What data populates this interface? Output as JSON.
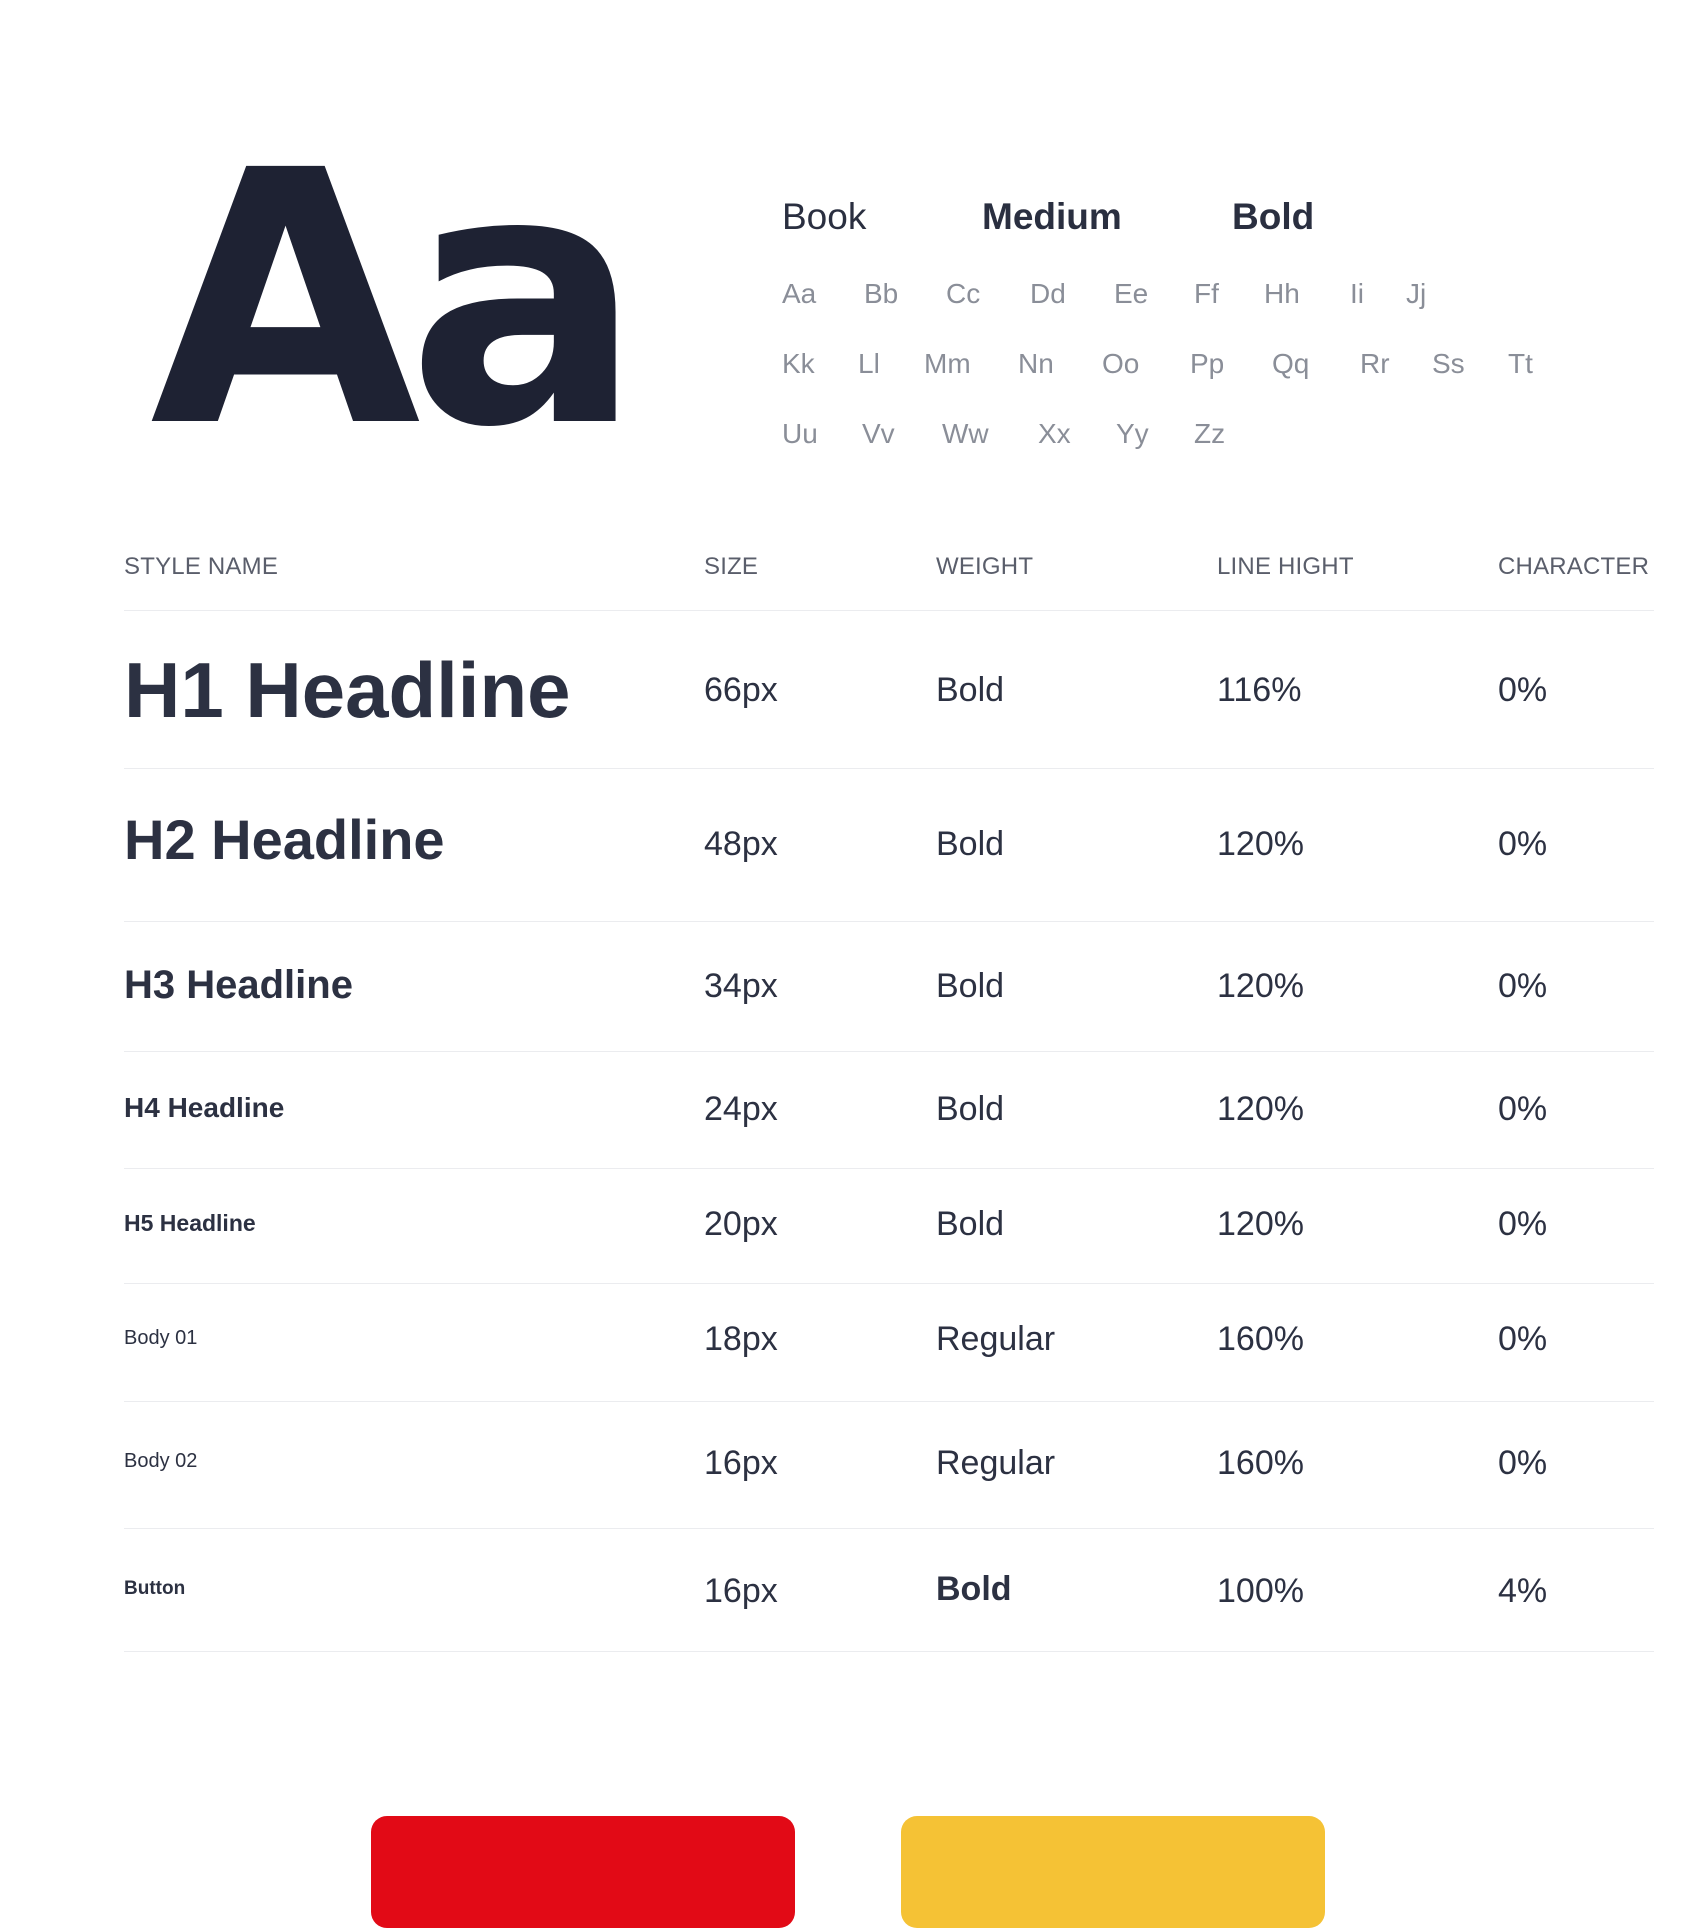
{
  "specimen": {
    "glyph": "Aa"
  },
  "weights": {
    "book": "Book",
    "medium": "Medium",
    "bold": "Bold"
  },
  "alphabet": {
    "row1": [
      "Aa",
      "Bb",
      "Cc",
      "Dd",
      "Ee",
      "Ff",
      "Hh",
      "Ii",
      "Jj"
    ],
    "row2": [
      "Kk",
      "Ll",
      "Mm",
      "Nn",
      "Oo",
      "Pp",
      "Qq",
      "Rr",
      "Ss",
      "Tt"
    ],
    "row3": [
      "Uu",
      "Vv",
      "Ww",
      "Xx",
      "Yy",
      "Zz"
    ]
  },
  "table": {
    "headers": {
      "style_name": "STYLE NAME",
      "size": "SIZE",
      "weight": "WEIGHT",
      "line_height": "LINE HIGHT",
      "character": "CHARACTER"
    },
    "rows": [
      {
        "name": "H1 Headline",
        "size": "66px",
        "weight": "Bold",
        "line_height": "116%",
        "character": "0%"
      },
      {
        "name": "H2 Headline",
        "size": "48px",
        "weight": "Bold",
        "line_height": "120%",
        "character": "0%"
      },
      {
        "name": "H3 Headline",
        "size": "34px",
        "weight": "Bold",
        "line_height": "120%",
        "character": "0%"
      },
      {
        "name": "H4 Headline",
        "size": "24px",
        "weight": "Bold",
        "line_height": "120%",
        "character": "0%"
      },
      {
        "name": "H5 Headline",
        "size": "20px",
        "weight": "Bold",
        "line_height": "120%",
        "character": "0%"
      },
      {
        "name": "Body 01",
        "size": "18px",
        "weight": "Regular",
        "line_height": "160%",
        "character": "0%"
      },
      {
        "name": "Body 02",
        "size": "16px",
        "weight": "Regular",
        "line_height": "160%",
        "character": "0%"
      },
      {
        "name": "Button",
        "size": "16px",
        "weight": "Bold",
        "line_height": "100%",
        "character": "4%"
      }
    ]
  },
  "colors": {
    "red": "#e20a16",
    "yellow": "#f5c235",
    "text_dark": "#1e2233"
  }
}
